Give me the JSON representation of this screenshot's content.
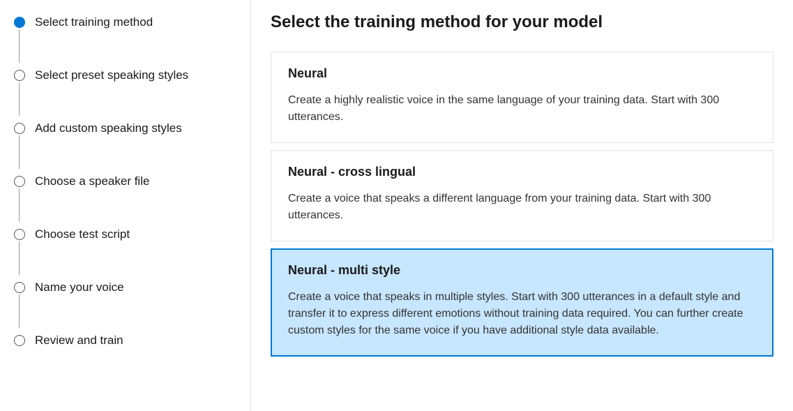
{
  "sidebar": {
    "steps": [
      {
        "label": "Select training method",
        "active": true
      },
      {
        "label": "Select preset speaking styles",
        "active": false
      },
      {
        "label": "Add custom speaking styles",
        "active": false
      },
      {
        "label": "Choose a speaker file",
        "active": false
      },
      {
        "label": "Choose test script",
        "active": false
      },
      {
        "label": "Name your voice",
        "active": false
      },
      {
        "label": "Review and train",
        "active": false
      }
    ]
  },
  "main": {
    "heading": "Select the training method for your model",
    "options": [
      {
        "title": "Neural",
        "description": "Create a highly realistic voice in the same language of your training data. Start with 300 utterances.",
        "selected": false
      },
      {
        "title": "Neural - cross lingual",
        "description": "Create a voice that speaks a different language from your training data. Start with 300 utterances.",
        "selected": false
      },
      {
        "title": "Neural - multi style",
        "description": "Create a voice that speaks in multiple styles. Start with 300 utterances in a default style and transfer it to express different emotions without training data required. You can further create custom styles for the same voice if you have additional style data available.",
        "selected": true
      }
    ]
  }
}
